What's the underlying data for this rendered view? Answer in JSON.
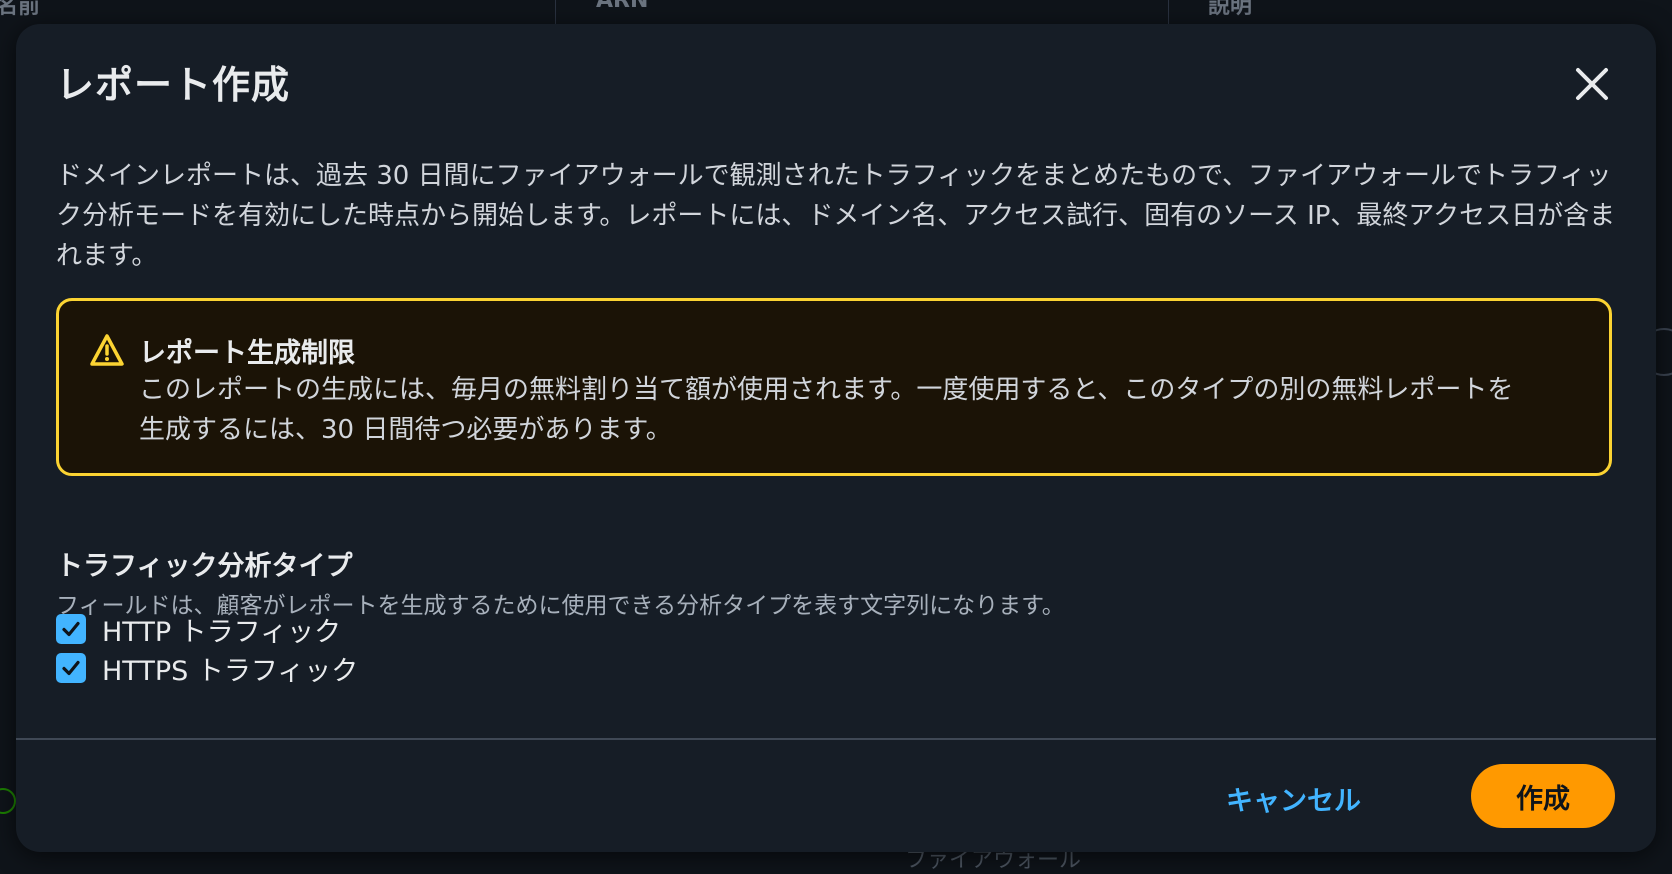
{
  "background": {
    "header_col1": "名前",
    "header_col2": "ARN",
    "header_col3": "説明",
    "footer_fragment": "ファイアウォール"
  },
  "modal": {
    "title": "レポート作成",
    "close_icon": "close-icon",
    "description": "ドメインレポートは、過去 30 日間にファイアウォールで観測されたトラフィックをまとめたもので、ファイアウォールでトラフィック分析モードを有効にした時点から開始します。レポートには、ドメイン名、アクセス試行、固有のソース IP、最終アクセス日が含まれます。",
    "alert": {
      "icon": "warning-icon",
      "title": "レポート生成制限",
      "body": "このレポートの生成には、毎月の無料割り当て額が使用されます。一度使用すると、このタイプの別の無料レポートを生成するには、30 日間待つ必要があります。"
    },
    "field": {
      "label": "トラフィック分析タイプ",
      "description": "フィールドは、顧客がレポートを生成するために使用できる分析タイプを表す文字列になります。",
      "options": [
        {
          "label": "HTTP トラフィック",
          "checked": true
        },
        {
          "label": "HTTPS トラフィック",
          "checked": true
        }
      ]
    },
    "footer": {
      "cancel_label": "キャンセル",
      "create_label": "作成"
    }
  },
  "colors": {
    "modal_bg": "#161d26",
    "alert_border": "#fbd332",
    "alert_bg": "#1b1306",
    "accent_blue": "#42b4ff",
    "primary_orange": "#ff9900"
  }
}
